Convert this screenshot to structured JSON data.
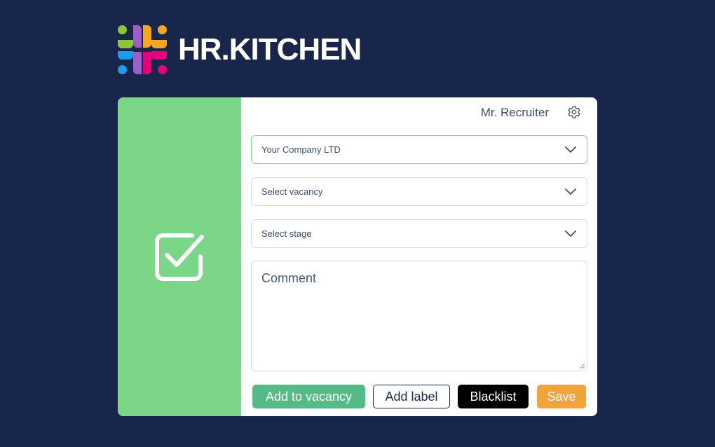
{
  "brand": {
    "logo_icon": "hr-kitchen-logo-icon",
    "name": "HR.KITCHEN",
    "logo_colors": [
      "#8cc63f",
      "#f5a623",
      "#1e9be8",
      "#e6007e",
      "#a05cc9",
      "#ffffff"
    ]
  },
  "sidebar": {
    "icon": "checkbox-checked-icon",
    "color": "#7bd688"
  },
  "header": {
    "user_name": "Mr. Recruiter",
    "settings_icon": "gear-icon"
  },
  "form": {
    "company_select": {
      "value": "Your Company LTD",
      "icon": "chevron-down-icon"
    },
    "vacancy_select": {
      "placeholder": "Select vacancy",
      "icon": "chevron-down-icon"
    },
    "stage_select": {
      "placeholder": "Select stage",
      "icon": "chevron-down-icon"
    },
    "comment": {
      "placeholder": "Comment",
      "value": ""
    }
  },
  "actions": {
    "add_to_vacancy": "Add to vacancy",
    "add_label": "Add label",
    "blacklist": "Blacklist",
    "save": "Save"
  },
  "colors": {
    "background": "#17264a",
    "accent_green": "#7bd688",
    "button_green": "#55bb86",
    "save_orange": "#f0a43a",
    "text": "#3c4f73"
  }
}
